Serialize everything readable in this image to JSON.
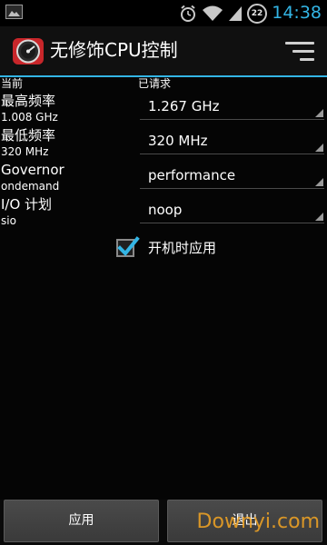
{
  "status_bar": {
    "time": "14:38",
    "battery_level": "22",
    "icons": [
      "image-notification-icon",
      "alarm-icon",
      "wifi-icon",
      "signal-icon",
      "battery-icon"
    ]
  },
  "action_bar": {
    "title": "无修饰CPU控制",
    "menu_icon": "menu-icon",
    "accent_color": "#33b5e5"
  },
  "current": {
    "header": "当前",
    "max_freq_label": "最高频率",
    "max_freq_value": "1.008 GHz",
    "min_freq_label": "最低频率",
    "min_freq_value": "320 MHz",
    "governor_label": "Governor",
    "governor_value": "ondemand",
    "io_label": "I/O 计划",
    "io_value": "sio"
  },
  "requested": {
    "header": "已请求",
    "max_freq": "1.267 GHz",
    "min_freq": "320 MHz",
    "governor": "performance",
    "io_scheduler": "noop"
  },
  "apply_on_boot": {
    "label": "开机时应用",
    "checked": true
  },
  "buttons": {
    "apply": "应用",
    "exit": "退出"
  },
  "watermark": "Downyi.com"
}
